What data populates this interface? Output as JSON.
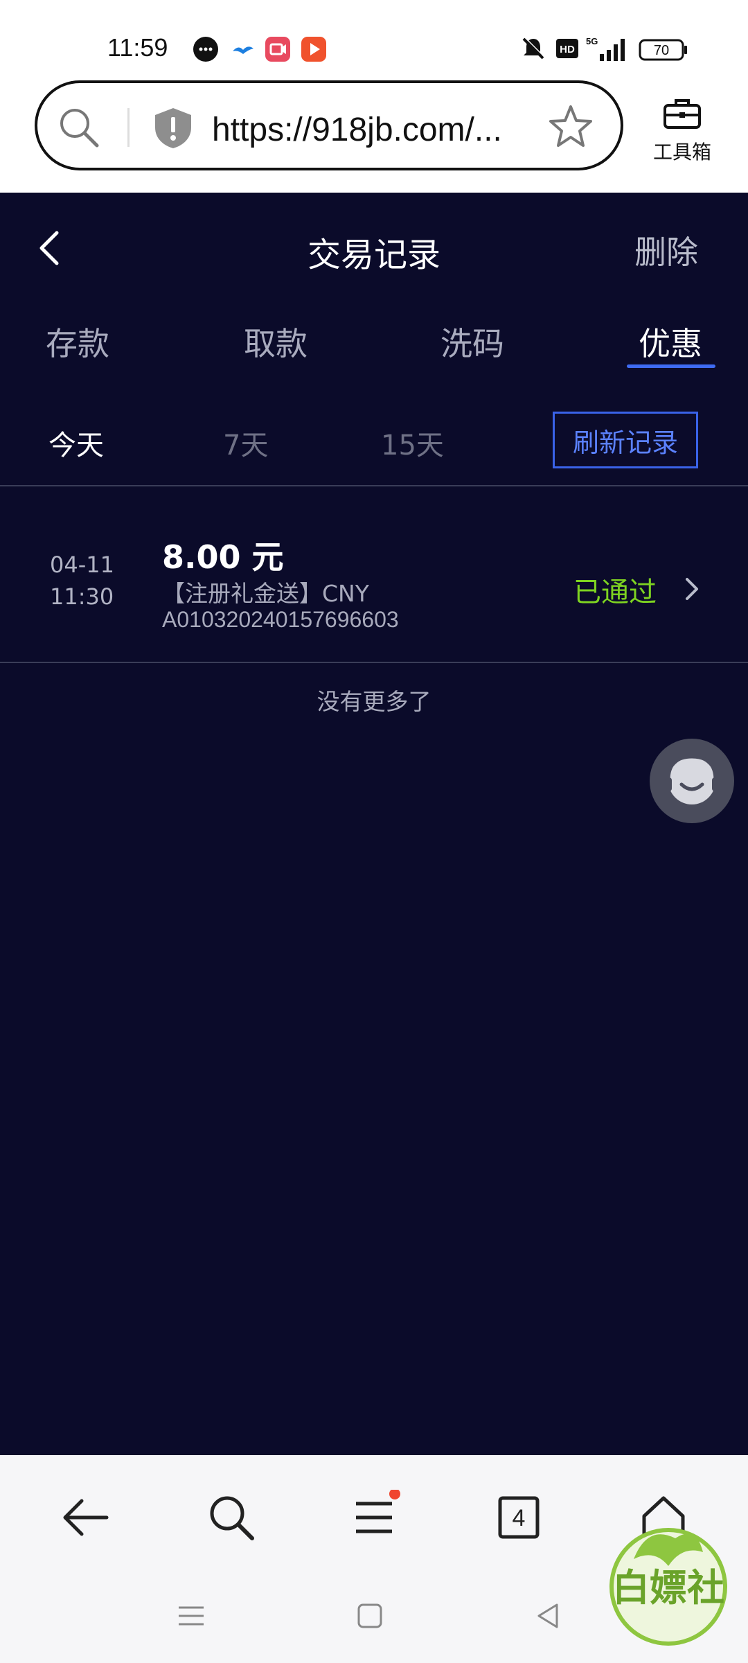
{
  "status_bar": {
    "time": "11:59",
    "battery": "70"
  },
  "browser": {
    "url": "https://918jb.com/...",
    "toolbox_label": "工具箱"
  },
  "header": {
    "title": "交易记录",
    "delete_label": "删除"
  },
  "tabs": [
    {
      "label": "存款",
      "active": false
    },
    {
      "label": "取款",
      "active": false
    },
    {
      "label": "洗码",
      "active": false
    },
    {
      "label": "优惠",
      "active": true
    }
  ],
  "filters": {
    "today": "今天",
    "days7": "7天",
    "days15": "15天",
    "refresh": "刷新记录"
  },
  "records": [
    {
      "date": "04-11",
      "time": "11:30",
      "amount": "8.00 元",
      "description": "【注册礼金送】CNY",
      "id": "A010320240157696603",
      "status": "已通过"
    }
  ],
  "list_footer": "没有更多了",
  "bottom_nav": {
    "tab_count": "4"
  },
  "watermark": {
    "text": "白嫖社"
  },
  "colors": {
    "background": "#0b0b2a",
    "accent": "#3e6bf2",
    "status_green": "#7ed321"
  }
}
